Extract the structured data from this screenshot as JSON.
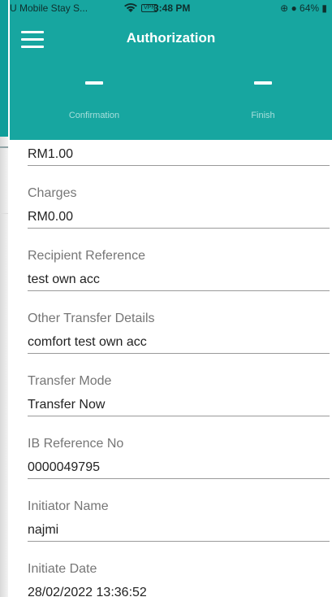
{
  "status_bar": {
    "carrier": "U Mobile Stay S...",
    "vpn": "VPN",
    "time": "3:48 PM",
    "right": "⊕ ● 64% ▮"
  },
  "header": {
    "title": "Authorization"
  },
  "steps": [
    {
      "label": "Confirmation"
    },
    {
      "label": "Finish"
    }
  ],
  "amount_value": "RM1.00",
  "fields": [
    {
      "label": "Charges",
      "value": "RM0.00"
    },
    {
      "label": "Recipient Reference",
      "value": "test own acc"
    },
    {
      "label": "Other Transfer Details",
      "value": "comfort test own acc"
    },
    {
      "label": "Transfer Mode",
      "value": "Transfer Now"
    },
    {
      "label": "IB Reference No",
      "value": "0000049795"
    },
    {
      "label": "Initiator Name",
      "value": "najmi"
    },
    {
      "label": "Initiate Date",
      "value": "28/02/2022 13:36:52"
    }
  ]
}
